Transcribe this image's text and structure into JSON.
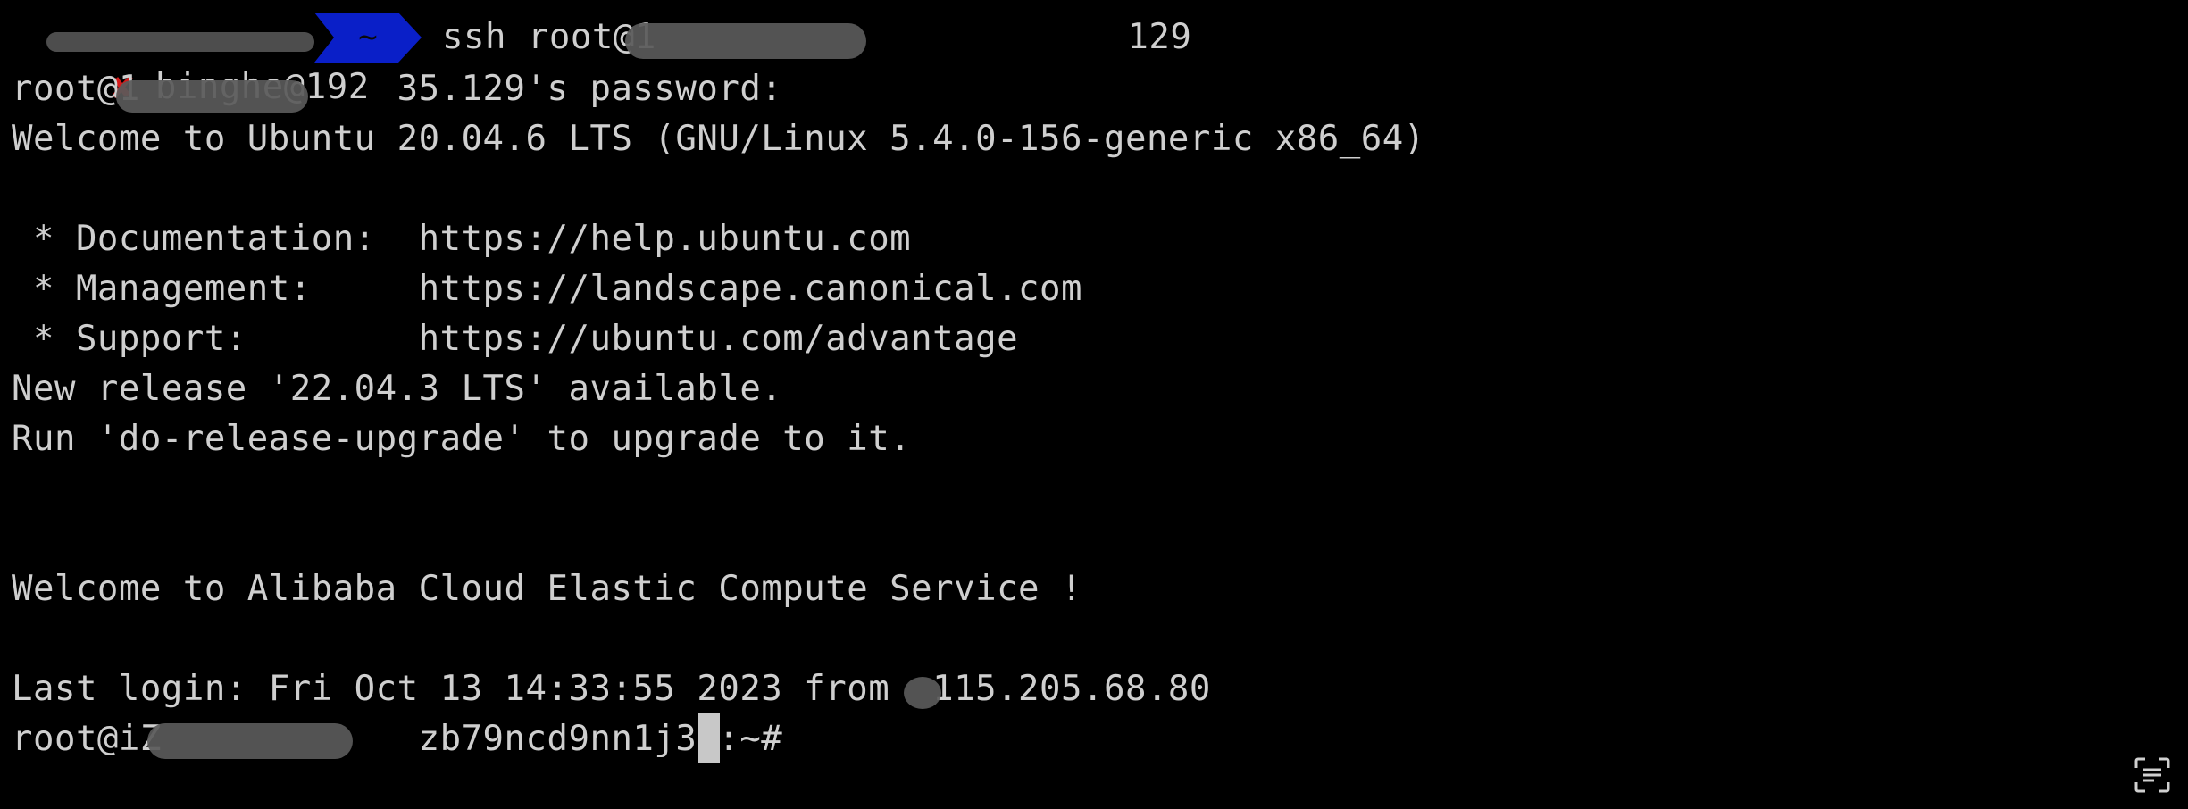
{
  "prompt": {
    "status_mark": "✘",
    "user_host": "binghe@192",
    "dir_segment": "~",
    "command": "ssh root@1                      129"
  },
  "lines": [
    "root@1            35.129's password:",
    "Welcome to Ubuntu 20.04.6 LTS (GNU/Linux 5.4.0-156-generic x86_64)",
    "",
    " * Documentation:  https://help.ubuntu.com",
    " * Management:     https://landscape.canonical.com",
    " * Support:        https://ubuntu.com/advantage",
    "New release '22.04.3 LTS' available.",
    "Run 'do-release-upgrade' to upgrade to it.",
    "",
    "",
    "Welcome to Alibaba Cloud Elastic Compute Service !",
    "",
    "Last login: Fri Oct 13 14:33:55 2023 from  115.205.68.80",
    "root@iZ            zb79ncd9nn1j3Z:~#"
  ],
  "colors": {
    "background": "#000000",
    "text": "#cfcfcf",
    "error_mark": "#d61a1a",
    "dir_segment": "#0a1fc8"
  },
  "icons": {
    "corner": "scan-text-icon"
  }
}
